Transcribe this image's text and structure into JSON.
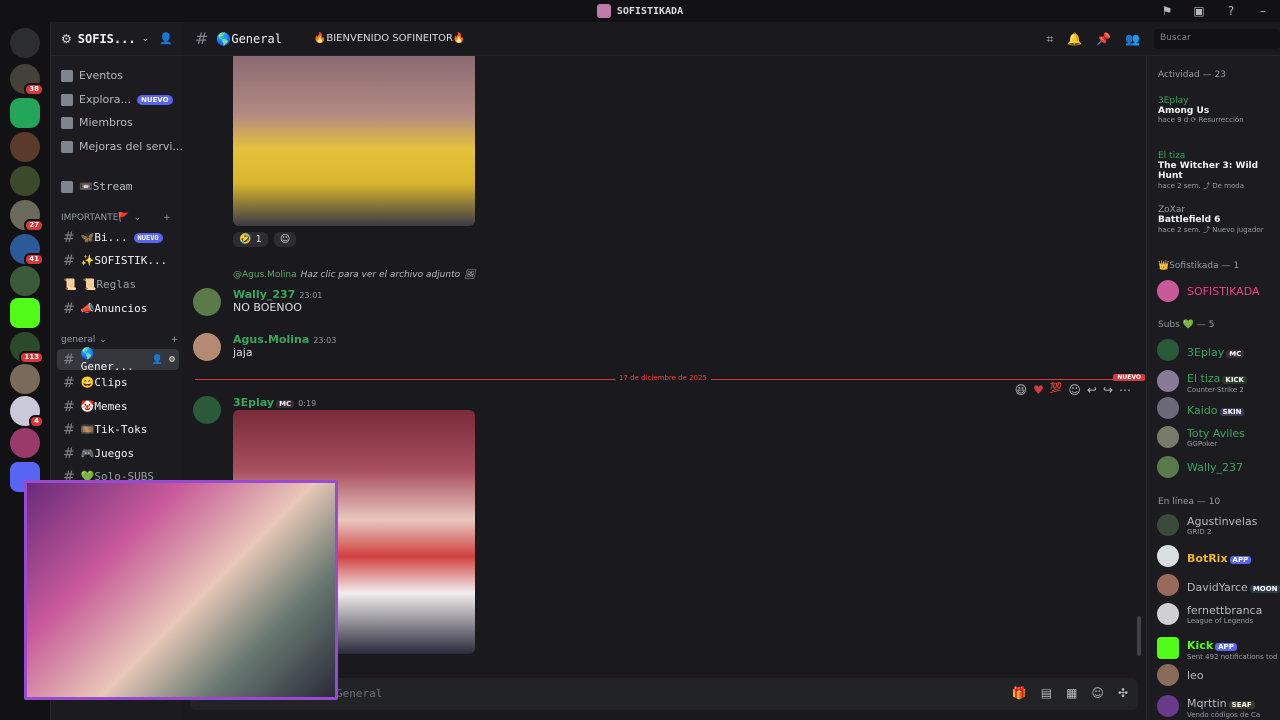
{
  "window": {
    "title": "SOFISTIKADA"
  },
  "server": {
    "name": "SOFIS...",
    "badges": [
      "38",
      "27",
      "41",
      "113",
      "4"
    ]
  },
  "nav": {
    "eventos": "Eventos",
    "explora": "Explora...",
    "explora_badge": "NUEVO",
    "miembros": "Miembros",
    "mejoras": "Mejoras del servi...",
    "stream": "📼Stream"
  },
  "categories": {
    "importante": "IMPORTANTE🚩",
    "general": "general"
  },
  "channels": [
    {
      "name": "🦋Bi...",
      "badge": "NUEVO"
    },
    {
      "name": "✨SOFISTIK..."
    },
    {
      "name": "📜Reglas"
    },
    {
      "name": "📣Anuncios"
    },
    {
      "name": "🌎Gener..."
    },
    {
      "name": "😄Clips"
    },
    {
      "name": "🤡Memes"
    },
    {
      "name": "🎞️Tik-Toks"
    },
    {
      "name": "🎮Juegos"
    },
    {
      "name": "💚Solo-SUBS"
    }
  ],
  "chat": {
    "channel": "🌎General",
    "topic": "🔥BIENVENIDO SOFINEITOR🔥",
    "search_placeholder": "Buscar",
    "composer_placeholder": "General",
    "reaction_count": "1",
    "reply_ref": {
      "who": "@Agus.Molina",
      "text": "Haz clic para ver el archivo adjunto"
    },
    "messages": [
      {
        "author": "Wally_237",
        "time": "23:01",
        "text": "NO BOENOO",
        "color": "#3ba55c"
      },
      {
        "author": "Agus.Molina",
        "time": "23:03",
        "text": "jaja",
        "color": "#3ba55c"
      },
      {
        "author": "3Eplay",
        "tag": "MC",
        "time": "0:19",
        "color": "#3ba55c"
      }
    ],
    "date_divider": "17 de diciembre de 2025",
    "new_label": "NUEVO"
  },
  "members": {
    "activity_header": "Actividad — 23",
    "activities": [
      {
        "user": "3Eplay",
        "game": "Among Us",
        "meta": "hace 9 d  ⟳ Resurrección"
      },
      {
        "user": "El tiza",
        "game": "The Witcher 3: Wild Hunt",
        "meta": "hace 2 sem.  ⤴ De moda"
      },
      {
        "user": "ZoXar",
        "game": "Battlefield 6",
        "meta": "hace 2 sem.  ⤴ Nuevo jugador"
      }
    ],
    "sofistikada_header": "👑Sofistikada — 1",
    "owner": "SOFISTIKADA",
    "subs_header": "Subs 💚 — 5",
    "subs": [
      {
        "name": "3Eplay",
        "tag": "MC",
        "sub": ""
      },
      {
        "name": "El tiza",
        "tag": "KICK",
        "sub": "Counter-Strike 2"
      },
      {
        "name": "Kaido",
        "tag": "SKIN",
        "sub": ""
      },
      {
        "name": "Toty Aviles",
        "tag": "",
        "sub": "GGPoker"
      },
      {
        "name": "Wally_237",
        "tag": "",
        "sub": ""
      }
    ],
    "online_header": "En línea — 10",
    "online": [
      {
        "name": "Agustinvelas",
        "tag": "",
        "sub": "GRID 2"
      },
      {
        "name": "BotRix",
        "tag": "APP",
        "sub": ""
      },
      {
        "name": "DavidYarce",
        "tag": "MOON",
        "sub": ""
      },
      {
        "name": "fernettbranca",
        "tag": "",
        "sub": "League of Legends"
      },
      {
        "name": "Kick",
        "tag": "APP",
        "sub": "Sent 492 notifications tod"
      },
      {
        "name": "leo",
        "tag": "",
        "sub": ""
      },
      {
        "name": "Mqrttin",
        "tag": "SEAF",
        "sub": "Vendo códigos de Ca"
      }
    ]
  }
}
